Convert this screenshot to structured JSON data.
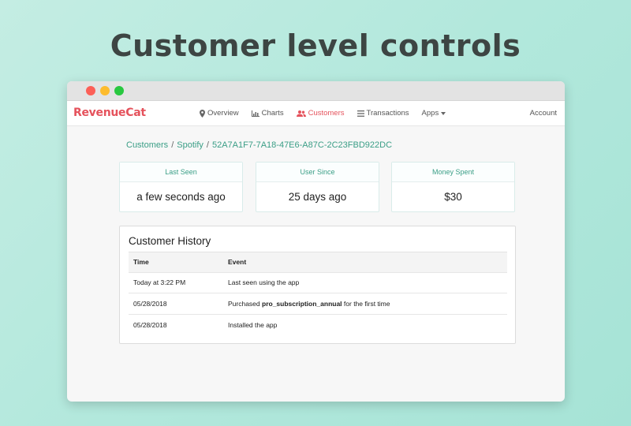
{
  "headline": "Customer level controls",
  "window": {
    "logo": "RevenueCat",
    "nav": {
      "items": [
        {
          "label": "Overview",
          "icon": "map-marker-icon"
        },
        {
          "label": "Charts",
          "icon": "bar-chart-icon"
        },
        {
          "label": "Customers",
          "icon": "users-icon",
          "active": true
        },
        {
          "label": "Transactions",
          "icon": "list-icon"
        },
        {
          "label": "Apps",
          "icon": "caret-down-icon"
        }
      ],
      "account": "Account"
    },
    "breadcrumb": {
      "items": [
        "Customers",
        "Spotify",
        "52A7A1F7-7A18-47E6-A87C-2C23FBD922DC"
      ],
      "separator": "/"
    },
    "stats": [
      {
        "label": "Last Seen",
        "value": "a few seconds ago"
      },
      {
        "label": "User Since",
        "value": "25 days ago"
      },
      {
        "label": "Money Spent",
        "value": "$30"
      }
    ],
    "history": {
      "title": "Customer History",
      "columns": [
        "Time",
        "Event"
      ],
      "rows": [
        {
          "time": "Today at 3:22 PM",
          "event_pre": "Last seen using the app",
          "event_bold": "",
          "event_post": ""
        },
        {
          "time": "05/28/2018",
          "event_pre": "Purchased ",
          "event_bold": "pro_subscription_annual",
          "event_post": " for the first time"
        },
        {
          "time": "05/28/2018",
          "event_pre": "Installed the app",
          "event_bold": "",
          "event_post": ""
        }
      ]
    }
  },
  "colors": {
    "brand": "#e5525c",
    "accent": "#3a9e86",
    "background": "#b2e8dc"
  }
}
